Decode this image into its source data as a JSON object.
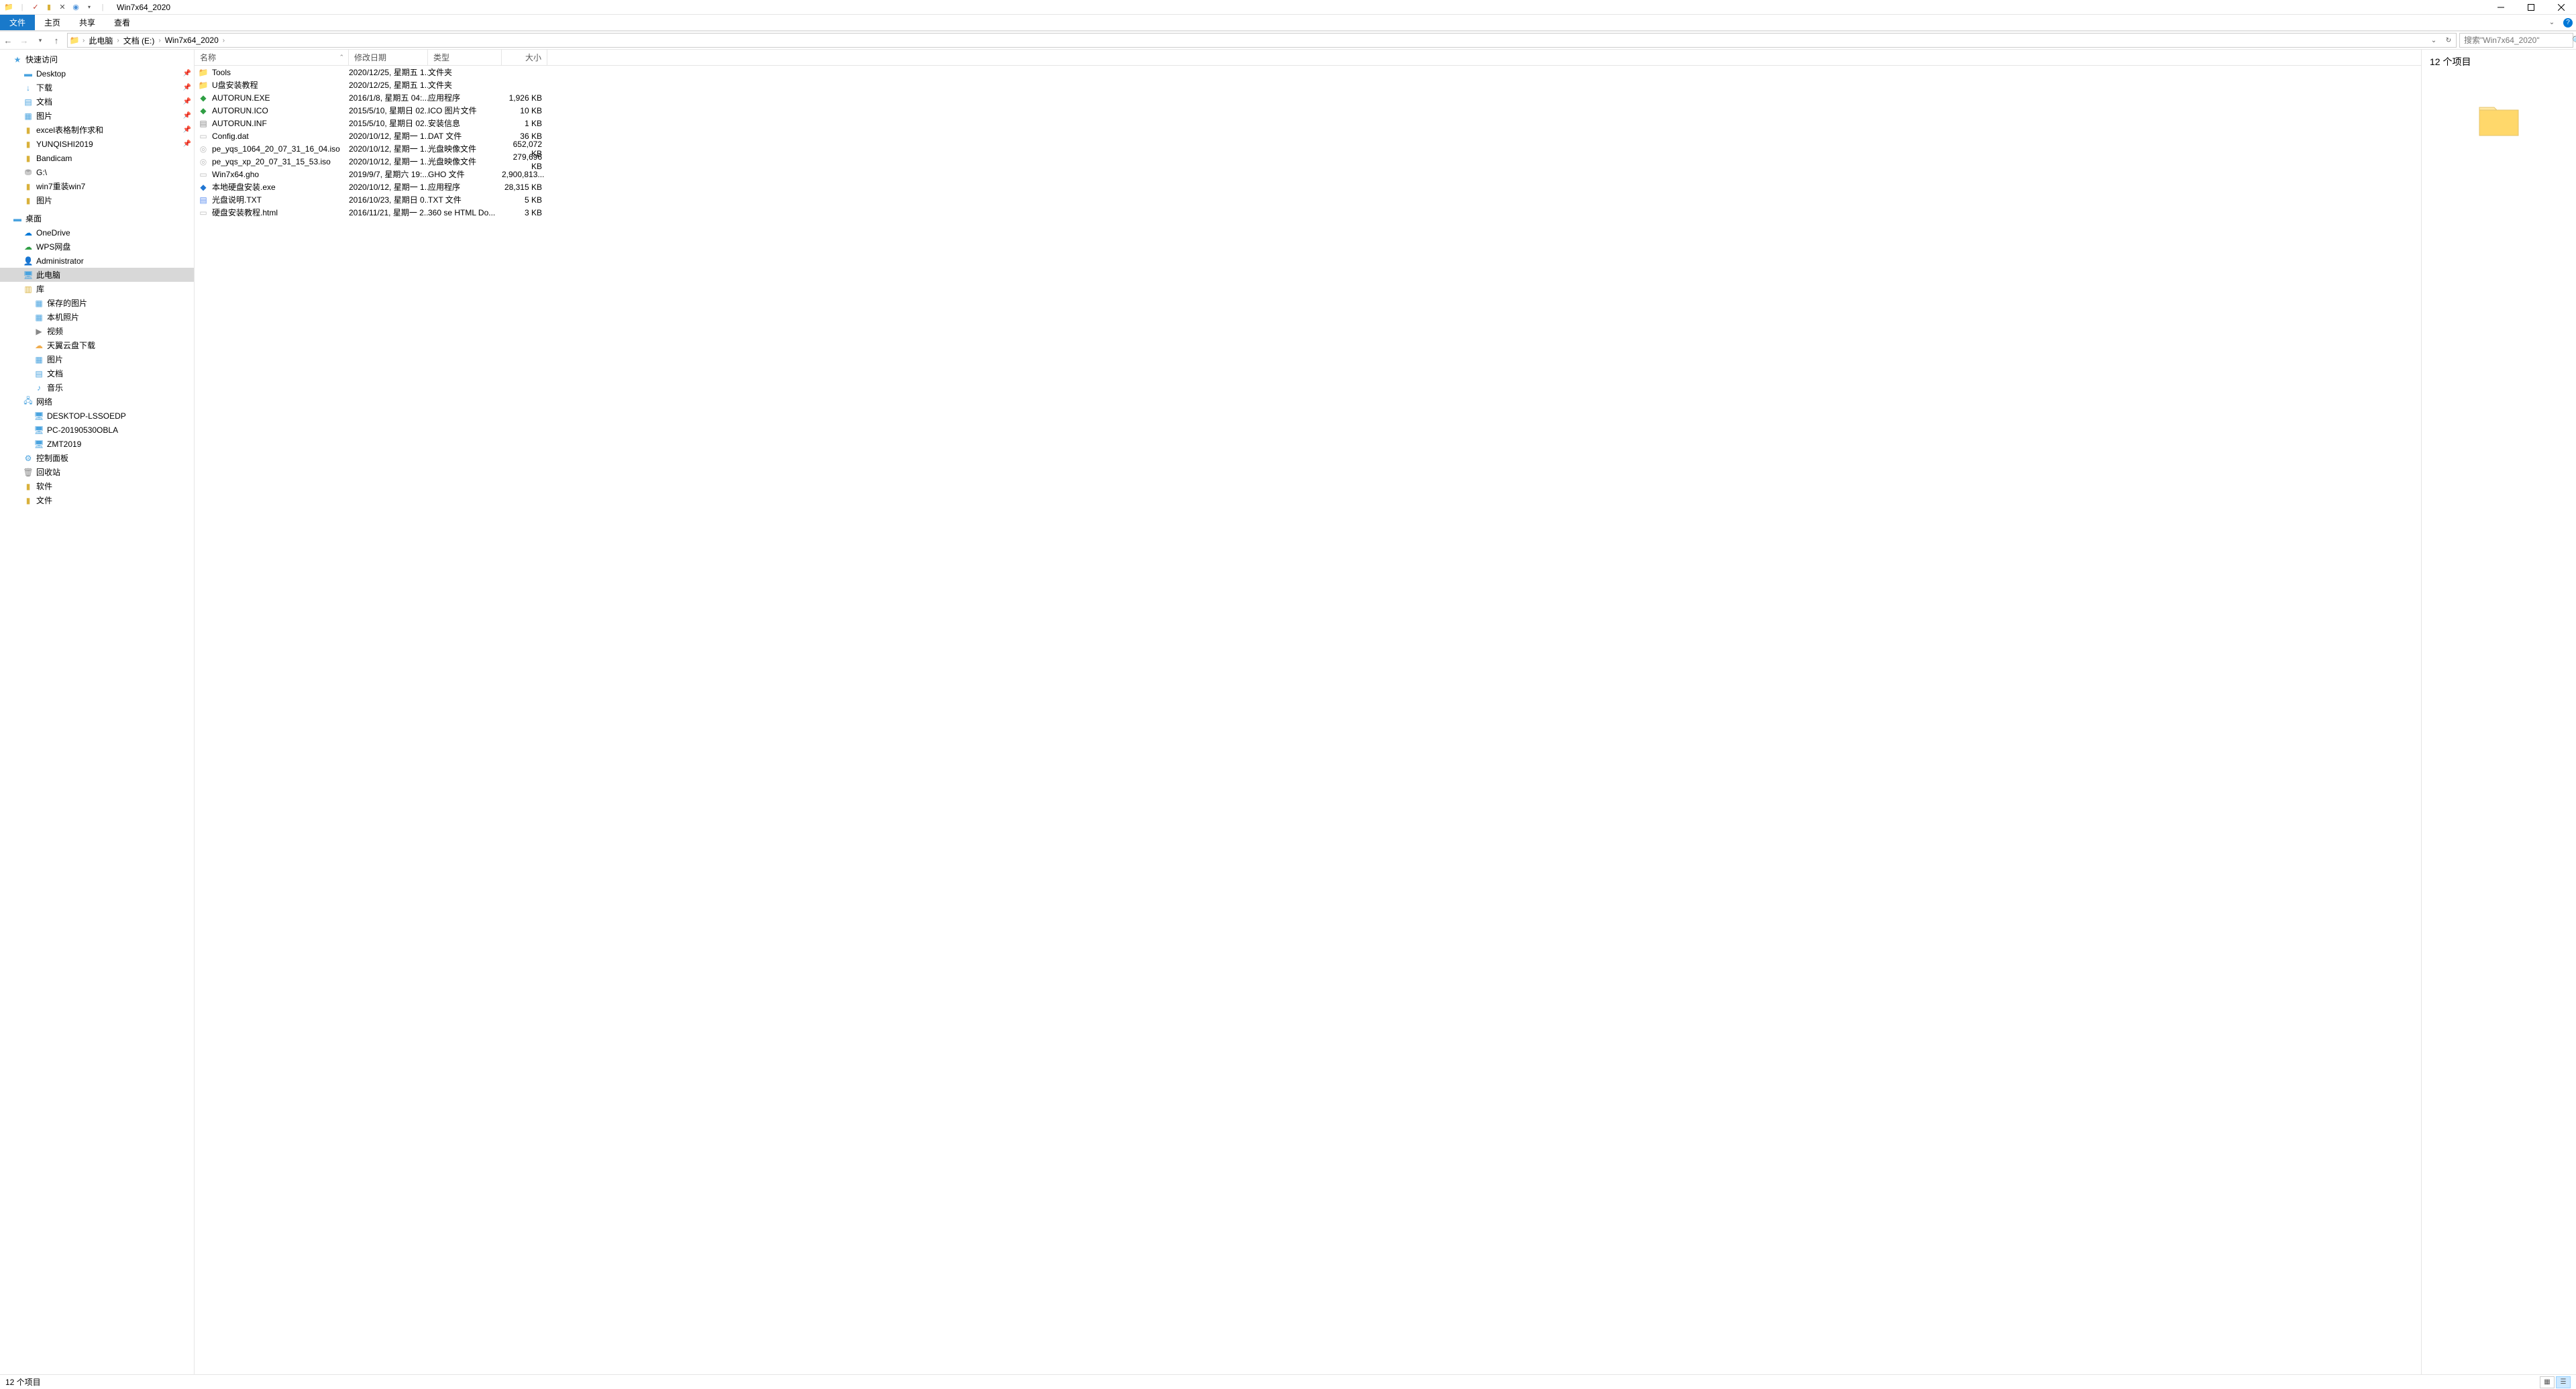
{
  "window": {
    "title": "Win7x64_2020"
  },
  "ribbon": {
    "file": "文件",
    "home": "主页",
    "share": "共享",
    "view": "查看"
  },
  "breadcrumb": {
    "root": "此电脑",
    "drive": "文档 (E:)",
    "folder": "Win7x64_2020"
  },
  "search": {
    "placeholder": "搜索\"Win7x64_2020\""
  },
  "nav": {
    "quick": "快速访问",
    "desktop": "Desktop",
    "downloads": "下载",
    "documents": "文档",
    "pictures": "图片",
    "excel": "excel表格制作求和",
    "yunqishi": "YUNQISHI2019",
    "bandicam": "Bandicam",
    "gdrive": "G:\\",
    "win7re": "win7重装win7",
    "pictures2": "图片",
    "desktop_zh": "桌面",
    "onedrive": "OneDrive",
    "wps": "WPS网盘",
    "admin": "Administrator",
    "thispc": "此电脑",
    "libraries": "库",
    "saved_pics": "保存的图片",
    "camera_roll": "本机照片",
    "videos": "视频",
    "tianyi": "天翼云盘下载",
    "pictures3": "图片",
    "documents2": "文档",
    "music": "音乐",
    "network": "网络",
    "pc1": "DESKTOP-LSSOEDP",
    "pc2": "PC-20190530OBLA",
    "pc3": "ZMT2019",
    "controlpanel": "控制面板",
    "recycle": "回收站",
    "software": "软件",
    "files_folder": "文件"
  },
  "cols": {
    "name": "名称",
    "date": "修改日期",
    "type": "类型",
    "size": "大小"
  },
  "files": [
    {
      "icon": "folder",
      "name": "Tools",
      "date": "2020/12/25, 星期五 1...",
      "type": "文件夹",
      "size": ""
    },
    {
      "icon": "folder",
      "name": "U盘安装教程",
      "date": "2020/12/25, 星期五 1...",
      "type": "文件夹",
      "size": ""
    },
    {
      "icon": "exe-green",
      "name": "AUTORUN.EXE",
      "date": "2016/1/8, 星期五 04:...",
      "type": "应用程序",
      "size": "1,926 KB"
    },
    {
      "icon": "ico",
      "name": "AUTORUN.ICO",
      "date": "2015/5/10, 星期日 02...",
      "type": "ICO 图片文件",
      "size": "10 KB"
    },
    {
      "icon": "inf",
      "name": "AUTORUN.INF",
      "date": "2015/5/10, 星期日 02...",
      "type": "安装信息",
      "size": "1 KB"
    },
    {
      "icon": "dat",
      "name": "Config.dat",
      "date": "2020/10/12, 星期一 1...",
      "type": "DAT 文件",
      "size": "36 KB"
    },
    {
      "icon": "iso",
      "name": "pe_yqs_1064_20_07_31_16_04.iso",
      "date": "2020/10/12, 星期一 1...",
      "type": "光盘映像文件",
      "size": "652,072 KB"
    },
    {
      "icon": "iso",
      "name": "pe_yqs_xp_20_07_31_15_53.iso",
      "date": "2020/10/12, 星期一 1...",
      "type": "光盘映像文件",
      "size": "279,696 KB"
    },
    {
      "icon": "gho",
      "name": "Win7x64.gho",
      "date": "2019/9/7, 星期六 19:...",
      "type": "GHO 文件",
      "size": "2,900,813..."
    },
    {
      "icon": "exe-blue",
      "name": "本地硬盘安装.exe",
      "date": "2020/10/12, 星期一 1...",
      "type": "应用程序",
      "size": "28,315 KB"
    },
    {
      "icon": "txt",
      "name": "光盘说明.TXT",
      "date": "2016/10/23, 星期日 0...",
      "type": "TXT 文件",
      "size": "5 KB"
    },
    {
      "icon": "html",
      "name": "硬盘安装教程.html",
      "date": "2016/11/21, 星期一 2...",
      "type": "360 se HTML Do...",
      "size": "3 KB"
    }
  ],
  "preview": {
    "title": "12 个项目"
  },
  "status": {
    "text": "12 个项目"
  }
}
